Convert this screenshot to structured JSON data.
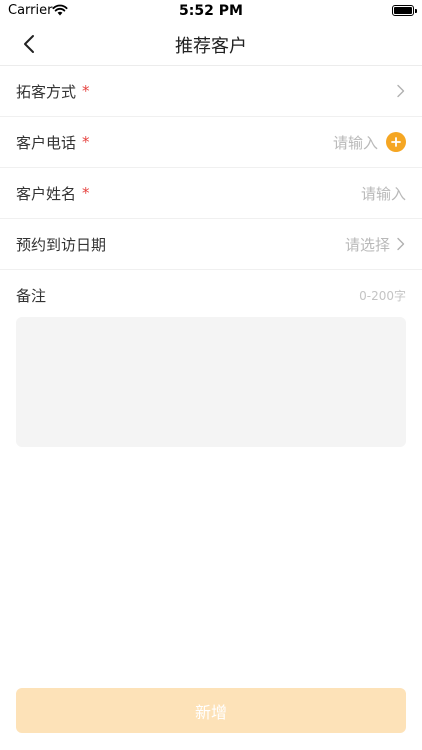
{
  "status_bar": {
    "carrier": "Carrier",
    "time": "5:52 PM"
  },
  "nav": {
    "title": "推荐客户",
    "back_icon": "chevron-left-icon"
  },
  "form": {
    "rows": [
      {
        "label": "拓客方式",
        "required": "*",
        "placeholder": "",
        "trailing_icon": "chevron-right-icon"
      },
      {
        "label": "客户电话",
        "required": "*",
        "placeholder": "请输入",
        "trailing_icon": "add-circle-icon"
      },
      {
        "label": "客户姓名",
        "required": "*",
        "placeholder": "请输入",
        "trailing_icon": ""
      },
      {
        "label": "预约到访日期",
        "required": "",
        "placeholder": "请选择",
        "trailing_icon": "chevron-right-icon"
      }
    ],
    "remark": {
      "label": "备注",
      "counter": "0-200字",
      "value": ""
    }
  },
  "submit": {
    "label": "新增"
  },
  "colors": {
    "accent": "#f5a623",
    "required": "#e64340",
    "submit_bg": "#fde2b8",
    "textarea_bg": "#f4f4f4"
  }
}
